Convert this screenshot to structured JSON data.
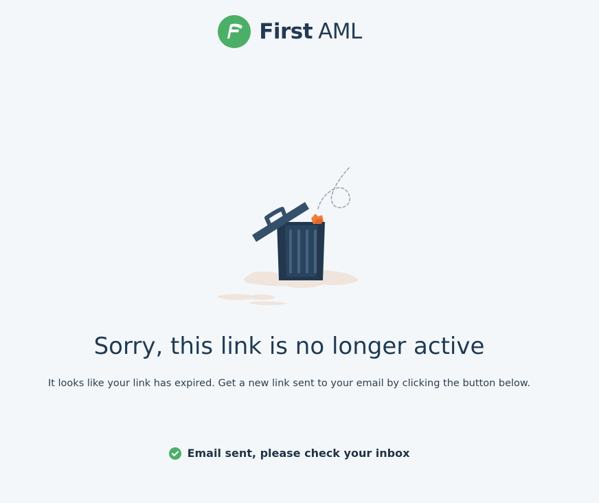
{
  "brand": {
    "name_bold": "First",
    "name_light": "AML",
    "accent_color": "#4caf68",
    "text_color": "#223b53"
  },
  "illustration": {
    "icon": "trash-can-icon"
  },
  "message": {
    "title": "Sorry, this link is no longer active",
    "body": "It looks like your link has expired. Get a new link sent to your email by clicking the button below."
  },
  "status": {
    "icon": "check-circle-icon",
    "text": "Email sent, please check your inbox",
    "color": "#4caf68"
  }
}
